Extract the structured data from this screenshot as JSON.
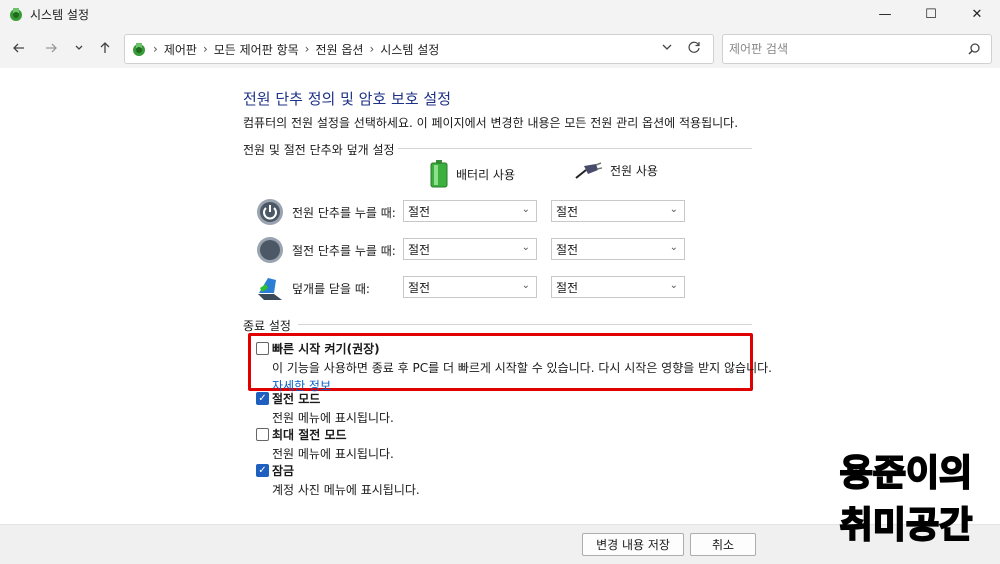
{
  "window": {
    "title": "시스템 설정",
    "controls": {
      "minimize": "—",
      "maximize": "☐",
      "close": "✕"
    }
  },
  "nav": {
    "back_icon": "arrow-left-icon",
    "forward_icon": "arrow-right-icon",
    "recent_icon": "chevron-down-icon",
    "up_icon": "arrow-up-icon",
    "breadcrumbs": [
      "제어판",
      "모든 제어판 항목",
      "전원 옵션",
      "시스템 설정"
    ],
    "search_placeholder": "제어판 검색"
  },
  "main": {
    "heading": "전원 단추 정의 및 암호 보호 설정",
    "description": "컴퓨터의 전원 설정을 선택하세요. 이 페이지에서 변경한 내용은 모든 전원 관리 옵션에 적용됩니다.",
    "section_buttons": "전원 및 절전 단추와 덮개 설정",
    "col_battery": "배터리 사용",
    "col_plugged": "전원 사용",
    "rows": [
      {
        "label": "전원 단추를 누를 때:",
        "battery": "절전",
        "plugged": "절전"
      },
      {
        "label": "절전 단추를 누를 때:",
        "battery": "절전",
        "plugged": "절전"
      },
      {
        "label": "덮개를 닫을 때:",
        "battery": "절전",
        "plugged": "절전"
      }
    ],
    "section_shutdown": "종료 설정",
    "options": [
      {
        "name": "빠른 시작 켜기(권장)",
        "checked": false,
        "desc": "이 기능을 사용하면 종료 후 PC를 더 빠르게 시작할 수 있습니다. 다시 시작은 영향을 받지 않습니다.",
        "link": "자세한 정보"
      },
      {
        "name": "절전 모드",
        "checked": true,
        "desc": "전원 메뉴에 표시됩니다."
      },
      {
        "name": "최대 절전 모드",
        "checked": false,
        "desc": "전원 메뉴에 표시됩니다."
      },
      {
        "name": "잠금",
        "checked": true,
        "desc": "계정 사진 메뉴에 표시됩니다."
      }
    ]
  },
  "footer": {
    "save": "변경 내용 저장",
    "cancel": "취소"
  },
  "watermark": {
    "line1": "용준이의",
    "line2": "취미공간"
  },
  "colors": {
    "heading": "#1e3287",
    "link": "#0a5fc4",
    "highlight_box": "#e00000",
    "checkbox_checked": "#1f5fbf"
  }
}
